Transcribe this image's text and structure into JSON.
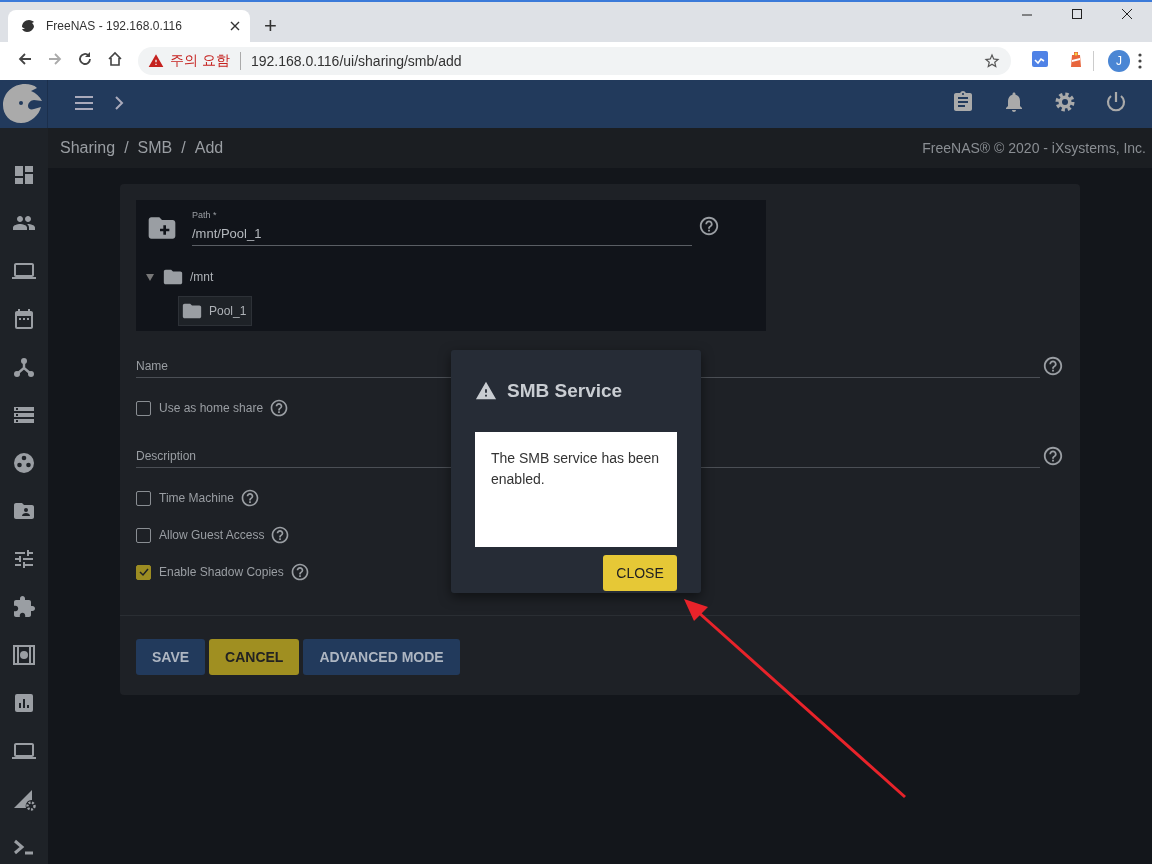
{
  "browser": {
    "tab_title": "FreeNAS - 192.168.0.116",
    "new_tab": "+",
    "security_warning": "주의 요함",
    "url": "192.168.0.116/ui/sharing/smb/add",
    "profile_initial": "J"
  },
  "breadcrumb": {
    "items": [
      "Sharing",
      "SMB",
      "Add"
    ],
    "separator": "/"
  },
  "copyright": "FreeNAS® © 2020 - iXsystems, Inc.",
  "form": {
    "path": {
      "label": "Path *",
      "value": "/mnt/Pool_1"
    },
    "tree": {
      "name": "/mnt",
      "expanded": true,
      "children": [
        {
          "name": "Pool_1",
          "selected": true
        }
      ]
    },
    "name_field": {
      "placeholder": "Name"
    },
    "description_field": {
      "placeholder": "Description"
    },
    "checkboxes": [
      {
        "label": "Use as home share",
        "checked": false
      },
      {
        "label": "Time Machine",
        "checked": false
      },
      {
        "label": "Allow Guest Access",
        "checked": false
      },
      {
        "label": "Enable Shadow Copies",
        "checked": true
      }
    ],
    "buttons": [
      {
        "label": "SAVE",
        "kind": "primary"
      },
      {
        "label": "CANCEL",
        "kind": "accent"
      },
      {
        "label": "ADVANCED MODE",
        "kind": "primary"
      }
    ]
  },
  "dialog": {
    "title": "SMB Service",
    "message": "The SMB service has been enabled.",
    "button": "CLOSE"
  }
}
